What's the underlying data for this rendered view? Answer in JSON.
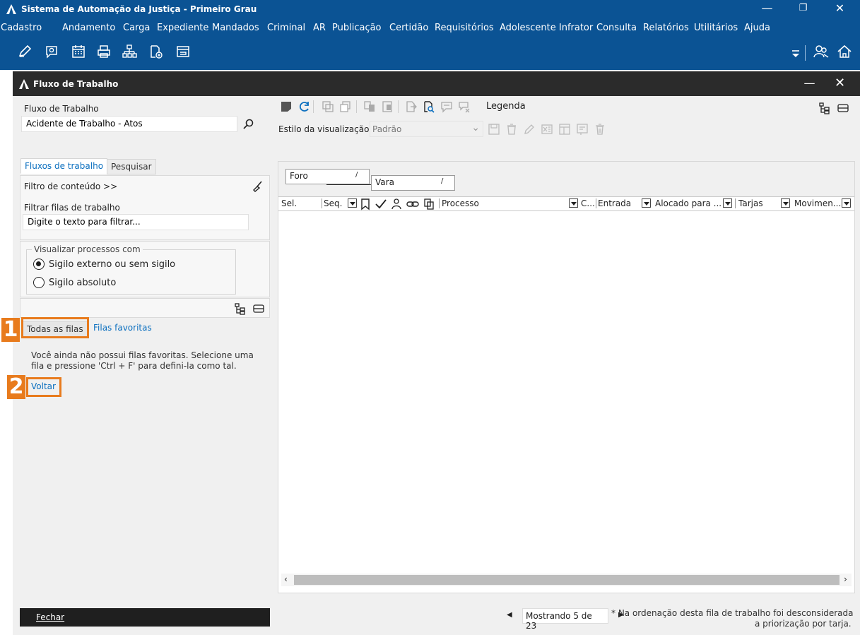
{
  "window": {
    "title": "Sistema de Automação da Justiça - Primeiro Grau"
  },
  "menu": [
    "Cadastro",
    "Andamento",
    "Carga",
    "Expediente",
    "Mandados",
    "Criminal",
    "AR",
    "Publicação",
    "Certidão",
    "Requisitórios",
    "Adolescente Infrator",
    "Consulta",
    "Relatórios",
    "Utilitários",
    "Ajuda"
  ],
  "toolbar_icons": [
    "edit-icon",
    "search-comment-icon",
    "calendar-icon",
    "printer-icon",
    "hierarchy-icon",
    "add-document-icon",
    "folder-icon"
  ],
  "subwindow": {
    "title": "Fluxo de Trabalho"
  },
  "left": {
    "fluxo_label": "Fluxo de Trabalho",
    "fluxo_value": "Acidente de Trabalho - Atos",
    "tabs": [
      "Fluxos de trabalho",
      "Pesquisar"
    ],
    "filtro_conteudo": "Filtro de conteúdo >>",
    "filtrar_label": "Filtrar filas de trabalho",
    "filtrar_placeholder": "Digite o texto para filtrar...",
    "visualizar_group": "Visualizar processos com",
    "radio_options": [
      {
        "label": "Sigilo externo ou sem sigilo",
        "selected": true
      },
      {
        "label": "Sigilo absoluto",
        "selected": false
      }
    ],
    "queue_tabs": [
      "Todas as filas",
      "Filas favoritas"
    ],
    "empty_line1": "Você ainda não possui filas favoritas. Selecione uma",
    "empty_line2": "fila e pressione 'Ctrl + F' para defini-la como tal.",
    "voltar": "Voltar",
    "fechar": "Fechar"
  },
  "annotations": [
    "1",
    "2"
  ],
  "right": {
    "legenda": "Legenda",
    "estilo_label": "Estilo da visualização",
    "estilo_value": "Padrão",
    "group_chips": [
      "Foro",
      "Vara"
    ],
    "chip_sort": "/",
    "columns": [
      "Sel.",
      "Seq.",
      "Processo",
      "C...",
      "Entrada",
      "Alocado para ...",
      "Tarjas",
      "Movimen..."
    ],
    "status_text": "Mostrando 5 de 23",
    "note_line1": "* Na ordenação desta fila de trabalho foi desconsiderada",
    "note_line2": "a priorização por tarja."
  }
}
